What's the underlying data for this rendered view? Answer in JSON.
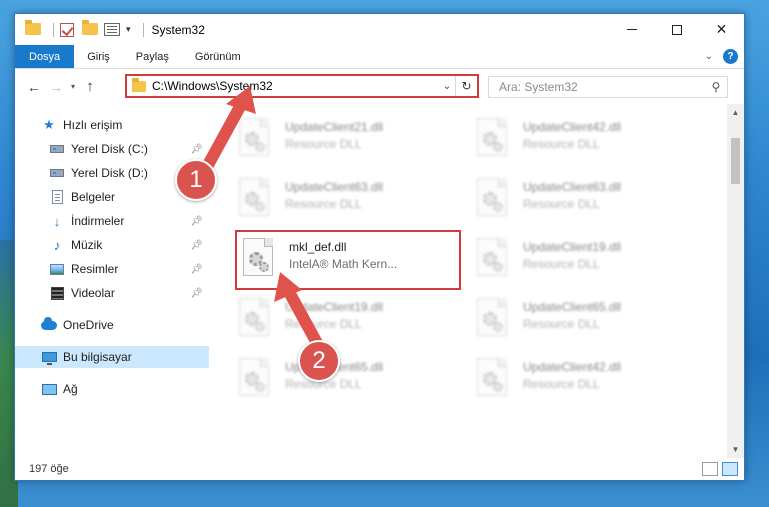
{
  "window": {
    "title": "System32"
  },
  "ribbon": {
    "tabs": [
      "Dosya",
      "Giriş",
      "Paylaş",
      "Görünüm"
    ],
    "help": "?"
  },
  "nav": {
    "back": "←",
    "forward": "→",
    "up": "↑"
  },
  "address": {
    "path": "C:\\Windows\\System32"
  },
  "search": {
    "placeholder": "Ara: System32"
  },
  "sidebar": {
    "items": [
      {
        "label": "Hızlı erişim",
        "icon": "star-icon"
      },
      {
        "label": "Yerel Disk (C:)",
        "icon": "drive-icon"
      },
      {
        "label": "Yerel Disk (D:)",
        "icon": "drive-icon"
      },
      {
        "label": "Belgeler",
        "icon": "documents-icon"
      },
      {
        "label": "İndirmeler",
        "icon": "downloads-icon"
      },
      {
        "label": "Müzik",
        "icon": "music-icon"
      },
      {
        "label": "Resimler",
        "icon": "pictures-icon"
      },
      {
        "label": "Videolar",
        "icon": "videos-icon"
      },
      {
        "label": "OneDrive",
        "icon": "onedrive-icon"
      },
      {
        "label": "Bu bilgisayar",
        "icon": "computer-icon"
      },
      {
        "label": "Ağ",
        "icon": "network-icon"
      }
    ],
    "selected": "Bu bilgisayar"
  },
  "files": [
    {
      "name": "UpdateClient21.dll",
      "desc": "Resource DLL",
      "blurred": true
    },
    {
      "name": "UpdateClient42.dll",
      "desc": "Resource DLL",
      "blurred": true
    },
    {
      "name": "UpdateClient63.dll",
      "desc": "Resource DLL",
      "blurred": true
    },
    {
      "name": "UpdateClient63.dll",
      "desc": "Resource DLL",
      "blurred": true
    },
    {
      "name": "mkl_def.dll",
      "desc": "IntelA® Math Kern...",
      "blurred": false
    },
    {
      "name": "UpdateClient19.dll",
      "desc": "Resource DLL",
      "blurred": true
    },
    {
      "name": "UpdateClient19.dll",
      "desc": "Resource DLL",
      "blurred": true
    },
    {
      "name": "UpdateClient65.dll",
      "desc": "Resource DLL",
      "blurred": true
    },
    {
      "name": "UpdateClient65.dll",
      "desc": "Resource DLL",
      "blurred": true
    },
    {
      "name": "UpdateClient42.dll",
      "desc": "Resource DLL",
      "blurred": true
    }
  ],
  "status": {
    "count": "197 öğe"
  },
  "callouts": [
    "1",
    "2"
  ],
  "colors": {
    "accent": "#1979ca",
    "highlight": "#d23b3b",
    "selection": "#cce8ff"
  }
}
